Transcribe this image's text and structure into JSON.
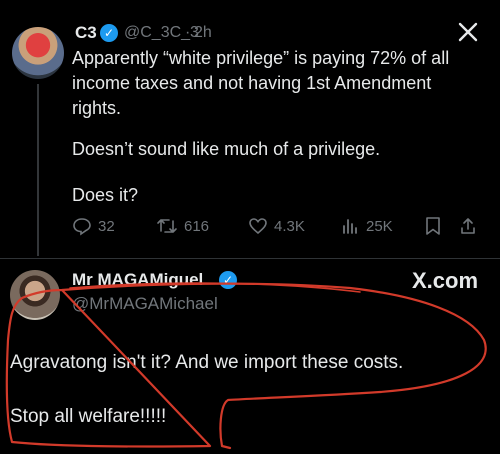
{
  "tweet": {
    "author_name": "C3",
    "author_handle": "@C_3C_3",
    "separator": "·",
    "time": "2h",
    "text_p1": "Apparently “white privilege” is paying 72% of all income taxes and not having 1st Amendment rights.",
    "text_p2": "Doesn’t sound like much of a privilege.",
    "text_p3": "Does it?",
    "stats": {
      "replies": "32",
      "reposts": "616",
      "likes": "4.3K",
      "views": "25K"
    }
  },
  "reply": {
    "author_name": "Mr MAGAMiguel",
    "author_handle": "@MrMAGAMichael",
    "platform_label": "X.com",
    "text_p1": "Agravatong isn't it? And we import these costs.",
    "text_p2": "Stop all welfare!!!!!"
  },
  "colors": {
    "background": "#000000",
    "text": "#e7e9ea",
    "muted": "#71767b",
    "verified": "#1d9bf0",
    "annotation": "#d23a2a"
  },
  "icons": [
    "verified-badge-icon",
    "x-logo-icon",
    "reply-icon",
    "repost-icon",
    "like-icon",
    "views-icon",
    "bookmark-icon",
    "share-icon"
  ]
}
